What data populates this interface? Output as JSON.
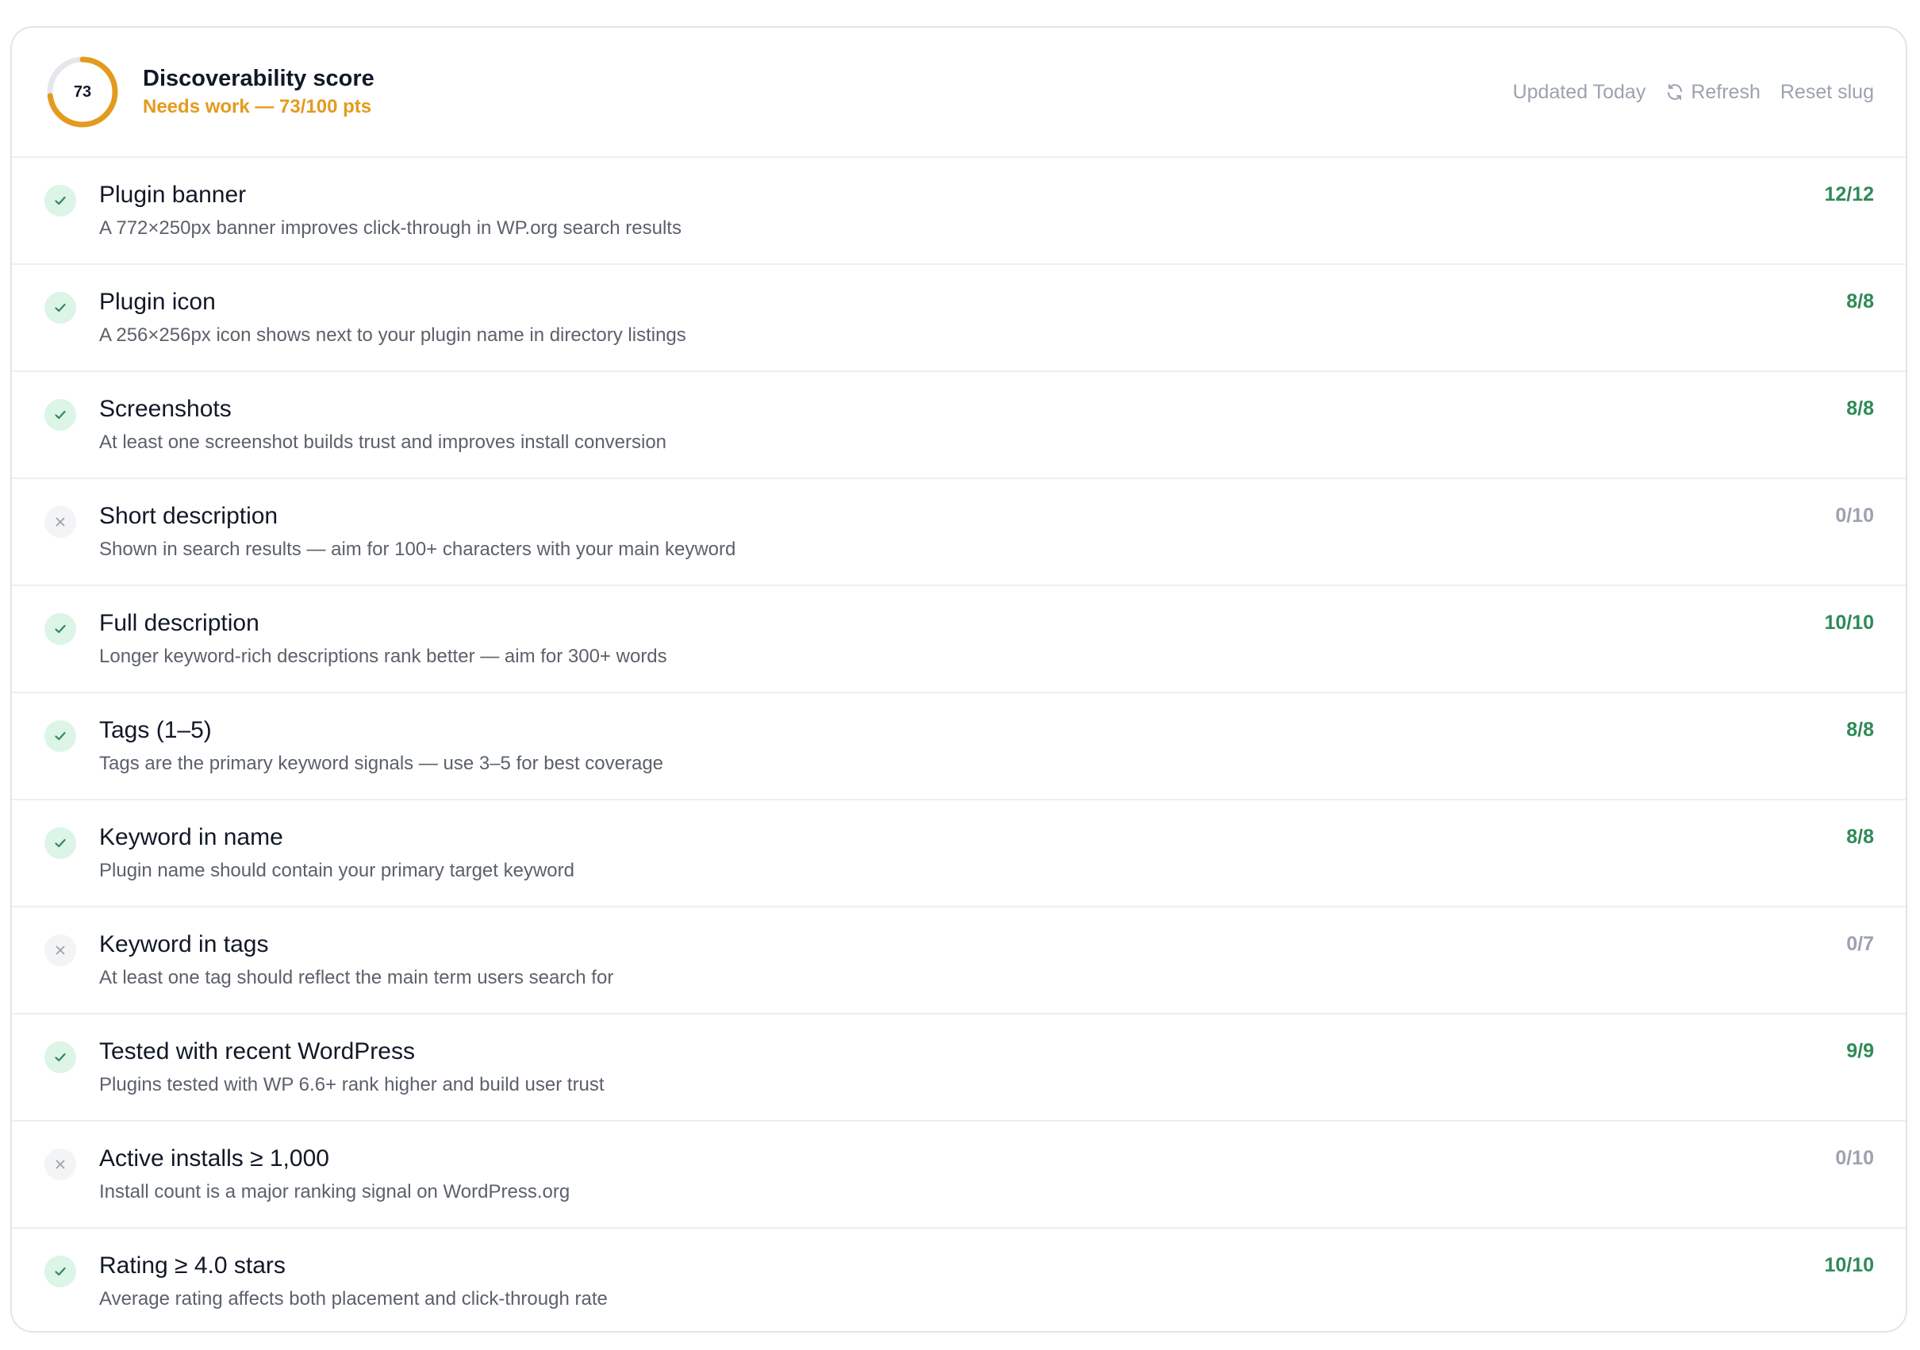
{
  "score": {
    "value": "73",
    "fraction": 0.73,
    "title": "Discoverability score",
    "status": "Needs work — 73/100 pts",
    "accent_color": "#e39b1f",
    "track_color": "#e5e7eb"
  },
  "header": {
    "updated": "Updated Today",
    "refresh_label": "Refresh",
    "refresh_icon": "refresh-icon",
    "reset_label": "Reset slug"
  },
  "checks": [
    {
      "title": "Plugin banner",
      "description": "A 772×250px banner improves click-through in WP.org search results",
      "score": "12/12",
      "passed": true
    },
    {
      "title": "Plugin icon",
      "description": "A 256×256px icon shows next to your plugin name in directory listings",
      "score": "8/8",
      "passed": true
    },
    {
      "title": "Screenshots",
      "description": "At least one screenshot builds trust and improves install conversion",
      "score": "8/8",
      "passed": true
    },
    {
      "title": "Short description",
      "description": "Shown in search results — aim for 100+ characters with your main keyword",
      "score": "0/10",
      "passed": false
    },
    {
      "title": "Full description",
      "description": "Longer keyword-rich descriptions rank better — aim for 300+ words",
      "score": "10/10",
      "passed": true
    },
    {
      "title": "Tags (1–5)",
      "description": "Tags are the primary keyword signals — use 3–5 for best coverage",
      "score": "8/8",
      "passed": true
    },
    {
      "title": "Keyword in name",
      "description": "Plugin name should contain your primary target keyword",
      "score": "8/8",
      "passed": true
    },
    {
      "title": "Keyword in tags",
      "description": "At least one tag should reflect the main term users search for",
      "score": "0/7",
      "passed": false
    },
    {
      "title": "Tested with recent WordPress",
      "description": "Plugins tested with WP 6.6+ rank higher and build user trust",
      "score": "9/9",
      "passed": true
    },
    {
      "title": "Active installs ≥ 1,000",
      "description": "Install count is a major ranking signal on WordPress.org",
      "score": "0/10",
      "passed": false
    },
    {
      "title": "Rating ≥ 4.0 stars",
      "description": "Average rating affects both placement and click-through rate",
      "score": "10/10",
      "passed": true
    }
  ],
  "colors": {
    "pass_text": "#2f8a57",
    "pass_bg": "#dcf5e6",
    "fail_text": "#9ca3af",
    "fail_bg": "#f3f4f6"
  }
}
